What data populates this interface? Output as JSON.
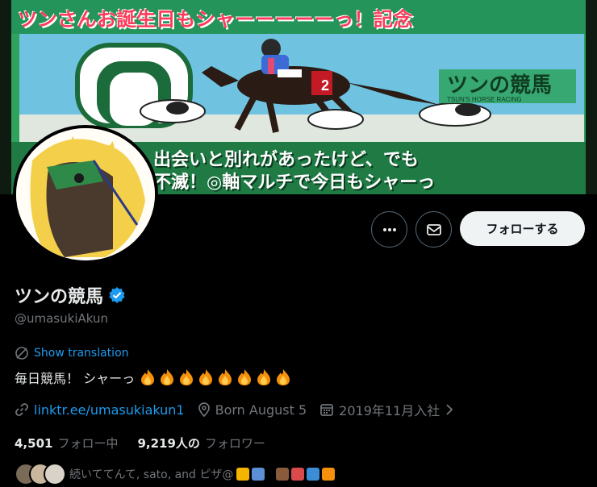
{
  "banner": {
    "title": "ツンさんお誕生日もシャーーーーーっ！記念",
    "logo_text": "ツンの競馬",
    "logo_sub": "TSUN'S HORSE RACING",
    "saddle_number": "2",
    "line1": "出会いと別れがあったけど、でも",
    "line2": "不滅！◎軸マルチで今日もシャーっ"
  },
  "profile": {
    "name": "ツンの競馬",
    "handle": "@umasukiAkun",
    "translate_label": "Show translation",
    "bio": "毎日競馬！ シャーっ",
    "bio_emoji": "fire-icon",
    "bio_emoji_count": 8
  },
  "actions": {
    "more_icon": "more-icon",
    "mail_icon": "mail-icon",
    "follow_label": "フォローする"
  },
  "meta": {
    "link": "linktr.ee/umasukiakun1",
    "birthday": "Born August 5",
    "joined": "2019年11月入社"
  },
  "stats": {
    "following_count": "4,501",
    "following_label": "フォロー中",
    "followers_count": "9,219人の",
    "followers_label": "フォロワー"
  },
  "followed_by": {
    "text": "続いててんて, sato, and ピザ@"
  },
  "colors": {
    "accent": "#1d9bf0",
    "verified": "#1d9bf0",
    "muted": "#71767b",
    "text": "#e7e9ea",
    "banner_green": "#2fa35e",
    "banner_title": "#ff3a5a"
  }
}
